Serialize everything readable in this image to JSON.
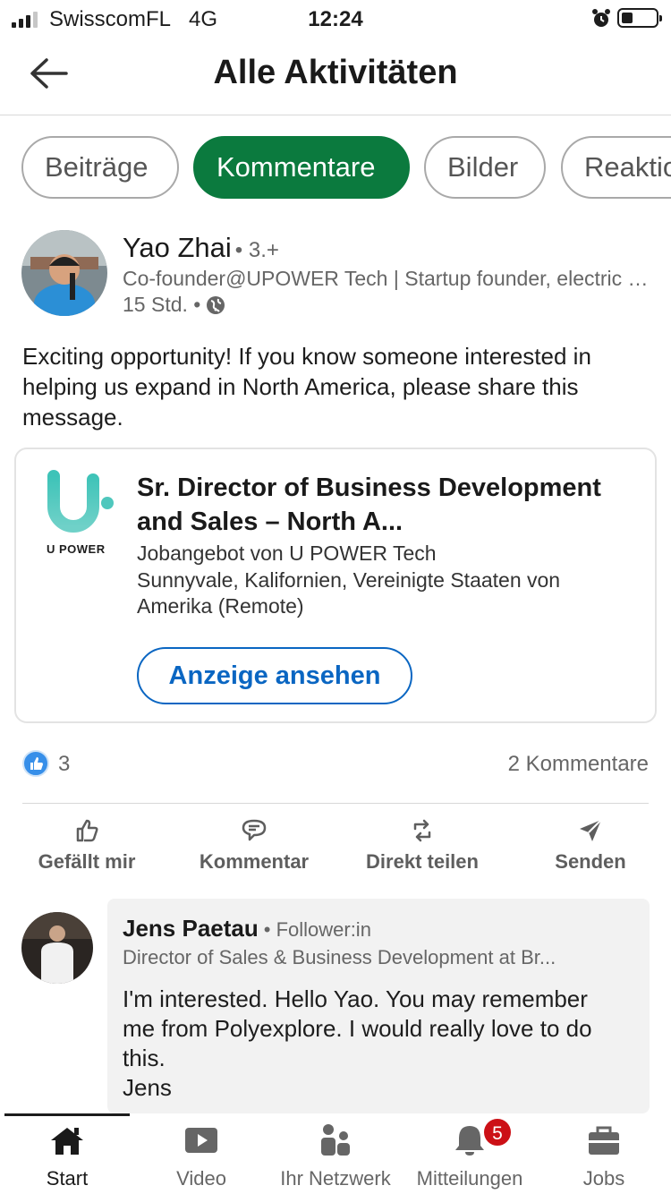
{
  "status_bar": {
    "carrier": "SwisscomFL",
    "network": "4G",
    "time": "12:24",
    "battery_level": 0.25
  },
  "header": {
    "title": "Alle Aktivitäten",
    "back_icon": "arrow-left-icon"
  },
  "filters": [
    {
      "label": "Beiträge",
      "active": false
    },
    {
      "label": "Kommentare",
      "active": true
    },
    {
      "label": "Bilder",
      "active": false
    },
    {
      "label": "Reaktionen",
      "active": false
    }
  ],
  "post": {
    "author": {
      "name": "Yao Zhai",
      "degree": "• 3.+",
      "headline": "Co-founder@UPOWER Tech | Startup founder, electric vehicle charging",
      "time": "15 Std. •",
      "visibility_icon": "globe-icon"
    },
    "text": "Exciting opportunity! If you know someone interested in helping us expand in North America, please share this message.",
    "job": {
      "logo_text": "U POWER",
      "title": "Sr. Director of Business Development and Sales – North A...",
      "company": "Jobangebot von U POWER Tech",
      "location": "Sunnyvale, Kalifornien, Vereinigte Staaten von Amerika (Remote)",
      "button": "Anzeige ansehen"
    },
    "reactions": {
      "count": "3",
      "comments": "2 Kommentare"
    },
    "actions": [
      {
        "label": "Gefällt mir",
        "icon": "thumbs-up-icon"
      },
      {
        "label": "Kommentar",
        "icon": "comment-icon"
      },
      {
        "label": "Direkt teilen",
        "icon": "repost-icon"
      },
      {
        "label": "Senden",
        "icon": "send-icon"
      }
    ]
  },
  "comment": {
    "name": "Jens Paetau",
    "relation": "• Follower:in",
    "headline": "Director of Sales & Business Development at Br...",
    "text": "I'm interested. Hello Yao. You may remember me from Polyexplore. I would really love to do this.\nJens"
  },
  "bottom_nav": [
    {
      "label": "Start",
      "icon": "home-icon",
      "active": true
    },
    {
      "label": "Video",
      "icon": "video-icon",
      "active": false
    },
    {
      "label": "Ihr Netzwerk",
      "icon": "network-icon",
      "active": false
    },
    {
      "label": "Mitteilungen",
      "icon": "bell-icon",
      "active": false,
      "badge": "5"
    },
    {
      "label": "Jobs",
      "icon": "briefcase-icon",
      "active": false
    }
  ],
  "colors": {
    "active_pill": "#0b7a3e",
    "link_blue": "#0a66c2",
    "badge_red": "#cc1016"
  }
}
